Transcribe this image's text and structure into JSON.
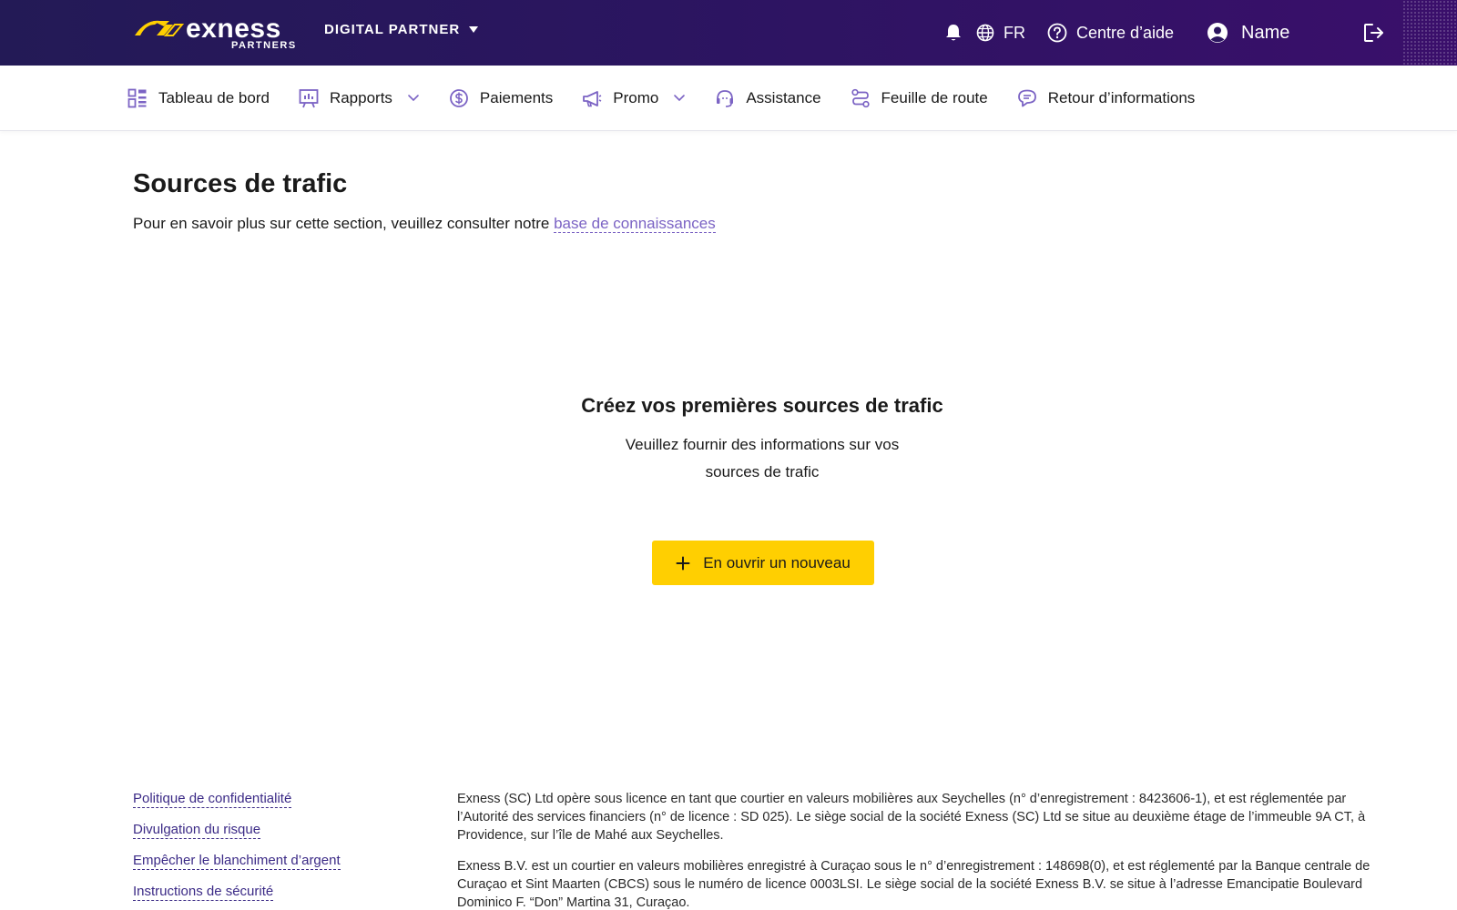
{
  "brand": {
    "name": "exness",
    "sub": "PARTNERS",
    "accent": "#ffcf01",
    "header_bg": "#2b1560",
    "link_color": "#7b63c4"
  },
  "topbar": {
    "program_label": "DIGITAL PARTNER",
    "language": "FR",
    "help_label": "Centre d’aide",
    "user_name": "Name"
  },
  "nav": {
    "items": [
      {
        "label": "Tableau de bord",
        "icon": "dashboard-icon"
      },
      {
        "label": "Rapports",
        "icon": "reports-icon",
        "dropdown": true
      },
      {
        "label": "Paiements",
        "icon": "dollar-icon"
      },
      {
        "label": "Promo",
        "icon": "megaphone-icon",
        "dropdown": true
      },
      {
        "label": "Assistance",
        "icon": "support-icon"
      },
      {
        "label": "Feuille de route",
        "icon": "roadmap-icon"
      },
      {
        "label": "Retour d’informations",
        "icon": "feedback-icon"
      }
    ]
  },
  "main": {
    "title": "Sources de trafic",
    "intro_text": "Pour en savoir plus sur cette section, veuillez consulter notre ",
    "intro_link": "base de connaissances",
    "empty_title": "Créez vos premières sources de trafic",
    "empty_text": "Veuillez fournir des informations sur vos sources de trafic",
    "cta_label": "En ouvrir un nouveau"
  },
  "footer": {
    "links": [
      "Politique de confidentialité",
      "Divulgation du risque",
      "Empêcher le blanchiment d’argent",
      "Instructions de sécurité"
    ],
    "legal": [
      "Exness (SC) Ltd opère sous licence en tant que courtier en valeurs mobilières aux Seychelles (n° d’enregistrement : 8423606-1), et est réglementée par l’Autorité des services financiers (n° de licence : SD 025). Le siège social de la société Exness (SC) Ltd se situe au deuxième étage de l’immeuble 9A CT, à Providence, sur l’île de Mahé aux Seychelles.",
      "Exness B.V. est un courtier en valeurs mobilières enregistré à Curaçao sous le n° d’enregistrement : 148698(0), et est réglementé par la Banque centrale de Curaçao et Sint Maarten (CBCS) sous le numéro de licence 0003LSI. Le siège social de la société Exness B.V. se situe à l’adresse Emancipatie Boulevard Dominico F. “Don” Martina 31, Curaçao."
    ]
  }
}
